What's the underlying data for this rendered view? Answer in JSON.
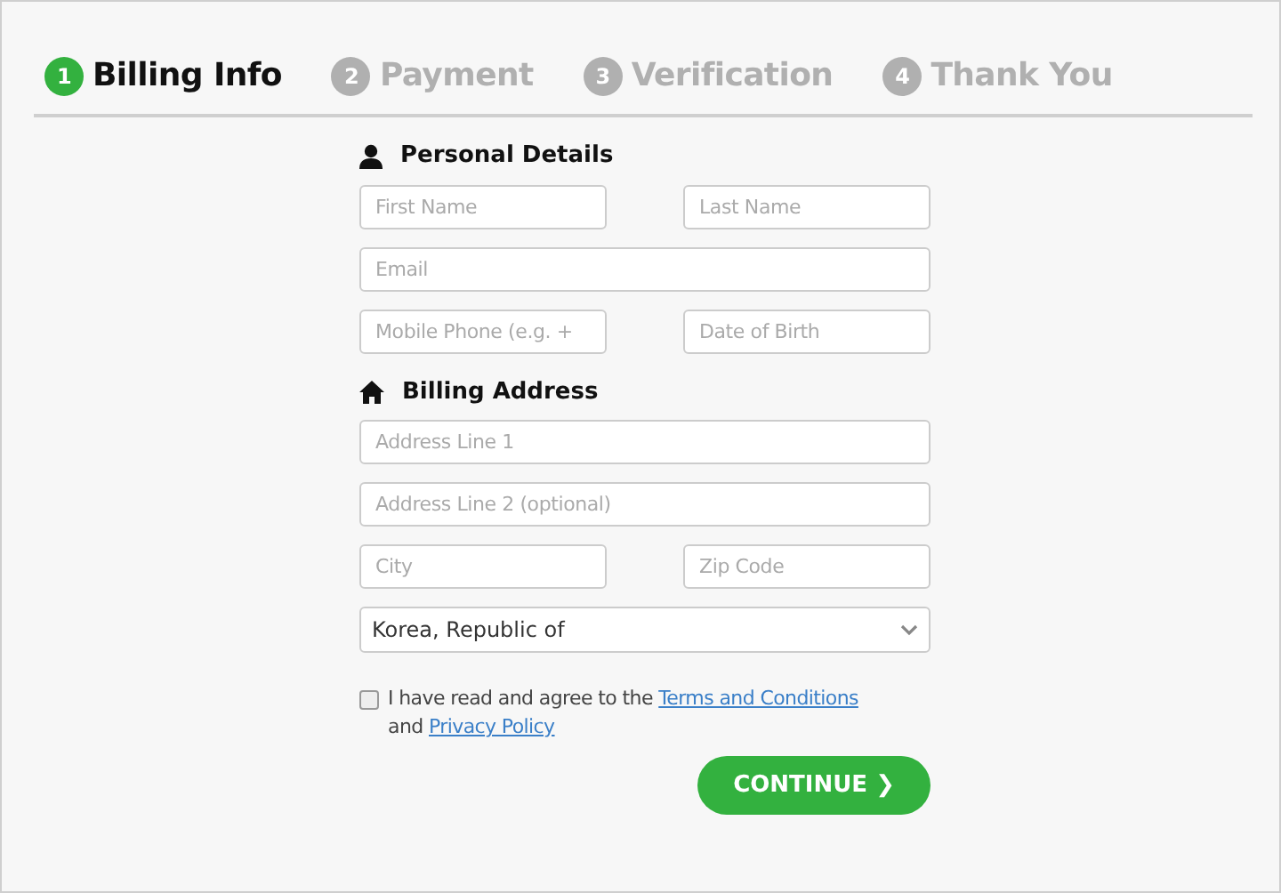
{
  "steps": [
    {
      "number": "1",
      "label": "Billing Info",
      "selected": true
    },
    {
      "number": "2",
      "label": "Payment",
      "selected": false
    },
    {
      "number": "3",
      "label": "Verification",
      "selected": false
    },
    {
      "number": "4",
      "label": "Thank You",
      "selected": false
    }
  ],
  "sections": [
    {
      "kind": "person",
      "title": "Personal Details",
      "rows": [
        [
          {
            "placeholder": "First Name"
          },
          {
            "placeholder": "Last Name"
          }
        ],
        [
          {
            "placeholder": "Email"
          }
        ],
        [
          {
            "placeholder": "Mobile Phone (e.g. +"
          },
          {
            "placeholder": "Date of Birth"
          }
        ]
      ]
    },
    {
      "kind": "home",
      "title": "Billing Address",
      "rows": [
        [
          {
            "placeholder": "Address Line 1"
          }
        ],
        [
          {
            "placeholder": "Address Line 2 (optional)"
          }
        ],
        [
          {
            "placeholder": "City"
          },
          {
            "placeholder": "Zip Code"
          }
        ],
        [
          {
            "kind": "select",
            "value": "Korea, Republic of"
          }
        ]
      ]
    }
  ],
  "agreement": {
    "checked": false,
    "text": "I have read and agree to the",
    "terms_link": "Terms and Conditions",
    "joiner": "and",
    "privacy_link": "Privacy Policy"
  },
  "continue_button": {
    "label": "CONTINUE",
    "icon": "❯"
  }
}
